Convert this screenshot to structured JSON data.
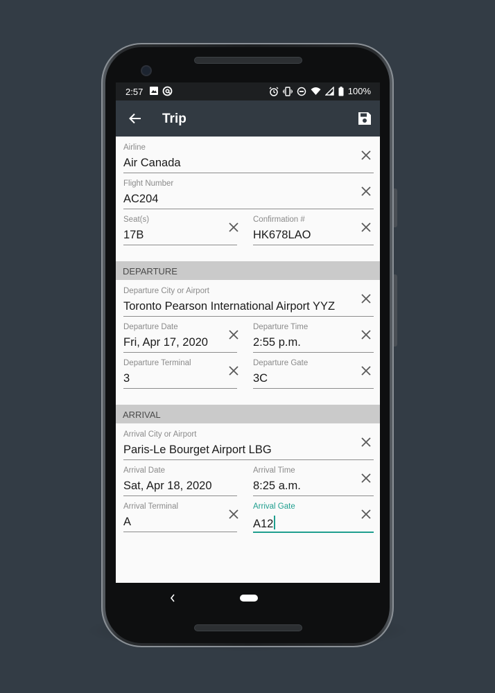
{
  "status": {
    "time": "2:57",
    "battery": "100%",
    "icons_left": [
      "image-icon",
      "at-icon"
    ],
    "icons_right": [
      "alarm-icon",
      "vibrate-icon",
      "dnd-icon",
      "wifi-icon",
      "signal-icon",
      "battery-icon"
    ]
  },
  "appbar": {
    "title": "Trip"
  },
  "flight": {
    "airline": {
      "label": "Airline",
      "value": "Air Canada"
    },
    "flight_number": {
      "label": "Flight Number",
      "value": "AC204"
    },
    "seats": {
      "label": "Seat(s)",
      "value": "17B"
    },
    "confirmation": {
      "label": "Confirmation #",
      "value": "HK678LAO"
    }
  },
  "departure": {
    "header": "DEPARTURE",
    "city": {
      "label": "Departure City or Airport",
      "value": "Toronto Pearson International Airport YYZ"
    },
    "date": {
      "label": "Departure Date",
      "value": "Fri, Apr 17, 2020"
    },
    "time": {
      "label": "Departure Time",
      "value": "2:55 p.m."
    },
    "terminal": {
      "label": "Departure Terminal",
      "value": "3"
    },
    "gate": {
      "label": "Departure Gate",
      "value": "3C"
    }
  },
  "arrival": {
    "header": "ARRIVAL",
    "city": {
      "label": "Arrival City or Airport",
      "value": "Paris-Le Bourget Airport LBG"
    },
    "date": {
      "label": "Arrival Date",
      "value": "Sat, Apr 18, 2020"
    },
    "time": {
      "label": "Arrival Time",
      "value": "8:25 a.m."
    },
    "terminal": {
      "label": "Arrival Terminal",
      "value": "A"
    },
    "gate": {
      "label": "Arrival Gate",
      "value": "A12"
    }
  },
  "colors": {
    "appbar": "#323a42",
    "accent": "#1e9e8e",
    "section": "#cacaca",
    "background": "#333c45"
  }
}
